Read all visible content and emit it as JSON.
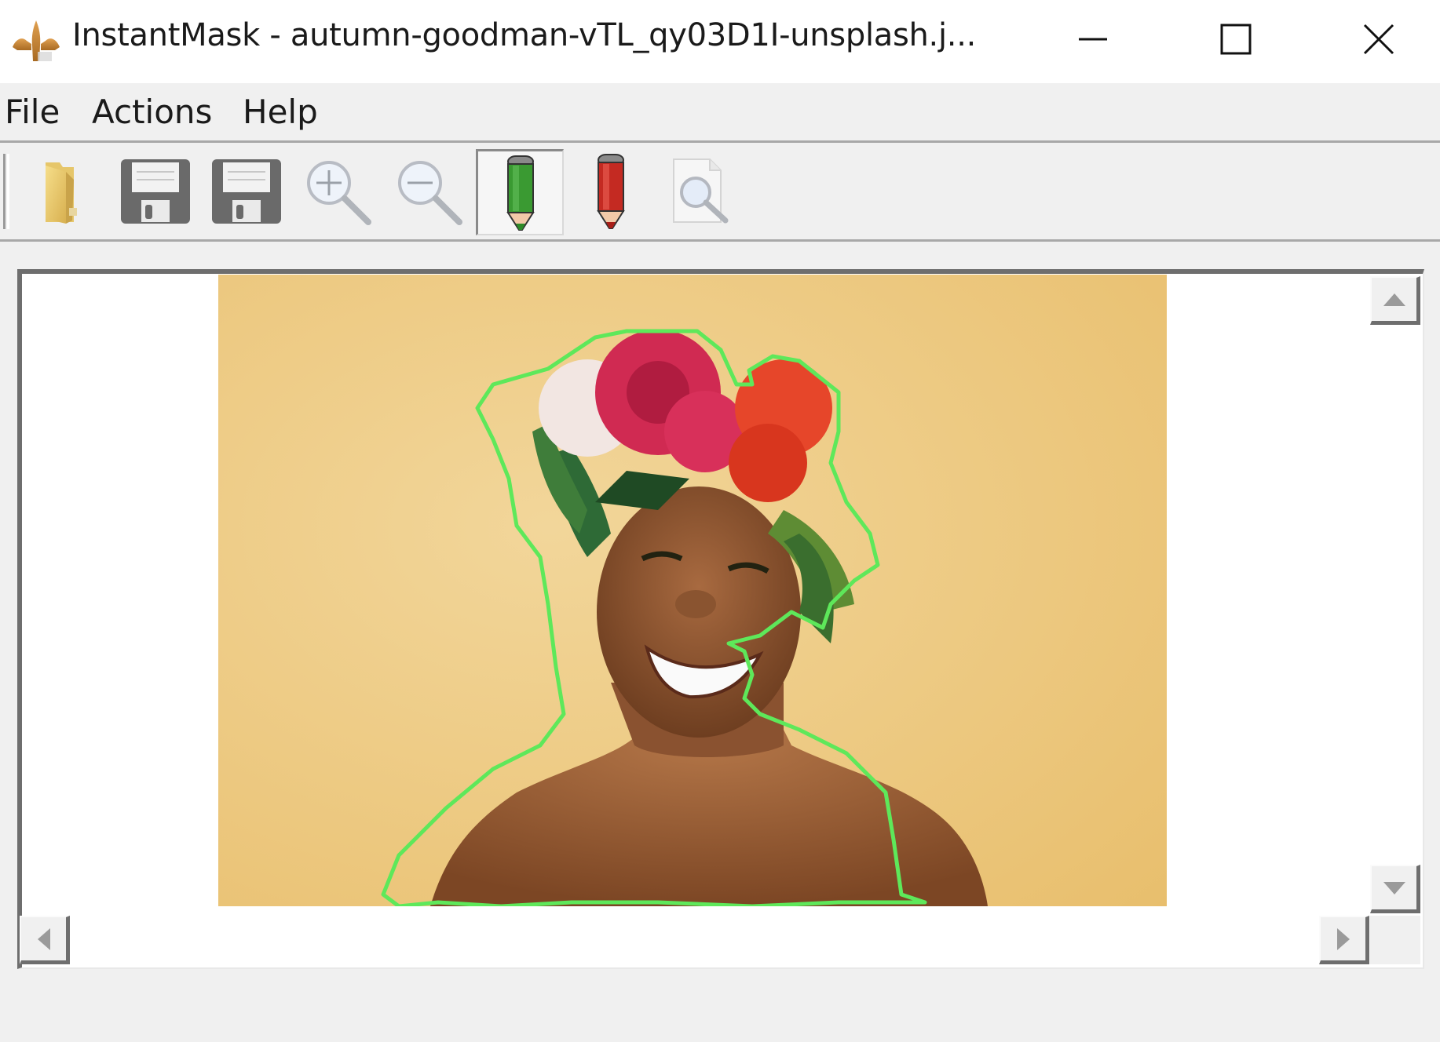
{
  "window": {
    "title": "InstantMask - autumn-goodman-vTL_qy03D1I-unsplash.j...",
    "app_icon": "fleur-de-lis-icon",
    "controls": {
      "minimize": "minimize-icon",
      "maximize": "maximize-icon",
      "close": "close-icon"
    }
  },
  "menubar": {
    "items": [
      {
        "label": "File"
      },
      {
        "label": "Actions"
      },
      {
        "label": "Help"
      }
    ]
  },
  "toolbar": {
    "buttons": [
      {
        "name": "open",
        "icon": "folder-icon",
        "active": false
      },
      {
        "name": "save",
        "icon": "floppy-disk-icon",
        "active": false
      },
      {
        "name": "save-as",
        "icon": "floppy-disk-icon",
        "active": false
      },
      {
        "name": "zoom-in",
        "icon": "zoom-in-icon",
        "active": false
      },
      {
        "name": "zoom-out",
        "icon": "zoom-out-icon",
        "active": false
      },
      {
        "name": "foreground-pencil",
        "icon": "green-pencil-icon",
        "active": true
      },
      {
        "name": "background-pencil",
        "icon": "red-pencil-icon",
        "active": false
      },
      {
        "name": "preview",
        "icon": "document-magnifier-icon",
        "active": false
      }
    ]
  },
  "canvas": {
    "image_description": "Smiling woman wearing flower crown against yellow background",
    "mask_outline_color": "#5ee85a",
    "background_color": "#eecb85"
  },
  "scrollbars": {
    "up": "scroll-up-arrow-icon",
    "down": "scroll-down-arrow-icon",
    "left": "scroll-left-arrow-icon",
    "right": "scroll-right-arrow-icon"
  }
}
